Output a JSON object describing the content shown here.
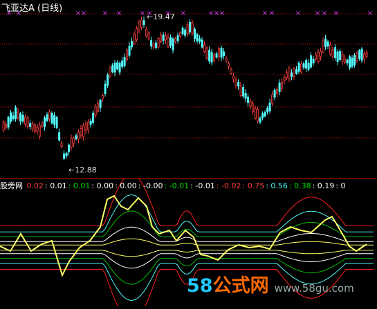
{
  "title": "飞亚达A (日线)",
  "main_chart": {
    "high_label": "19.47",
    "low_label": "12.88",
    "arrow_glyph": "←",
    "marker_glyph": "×",
    "marker_color": "#e040fb",
    "up_color": "#ff4040",
    "down_color": "#54fcfc",
    "gridline_color": "#b01010"
  },
  "indicator": {
    "name": "股旁网",
    "values": [
      {
        "text": "0.02",
        "color": "#ff4040"
      },
      {
        "text": "0.01",
        "color": "#ffffff"
      },
      {
        "text": "0.01",
        "color": "#00e000"
      },
      {
        "text": "0.00",
        "color": "#ffffff"
      },
      {
        "text": "0.00",
        "color": "#ffffff"
      },
      {
        "text": "-0.00",
        "color": "#ffffff"
      },
      {
        "text": "-0.01",
        "color": "#00e000"
      },
      {
        "text": "-0.01",
        "color": "#ffffff"
      },
      {
        "text": "-0.02",
        "color": "#ff4040"
      },
      {
        "text": "0.75",
        "color": "#ff4040"
      },
      {
        "text": "0.56",
        "color": "#54fcfc"
      },
      {
        "text": "0.38",
        "color": "#00e000"
      },
      {
        "text": "0.19",
        "color": "#ffffff"
      },
      {
        "text": "0",
        "color": "#ffffff"
      }
    ],
    "main_line_color": "#ffff66",
    "band_colors": [
      "#ff2020",
      "#54fcfc",
      "#00c000",
      "#ffffff",
      "#ffff66",
      "#ff2020"
    ]
  },
  "watermark": {
    "num": "58",
    "cn": "公式网",
    "url": "www.58gu.com",
    "num_color": "#22c8ff",
    "cn_color": "#ff6a00"
  }
}
